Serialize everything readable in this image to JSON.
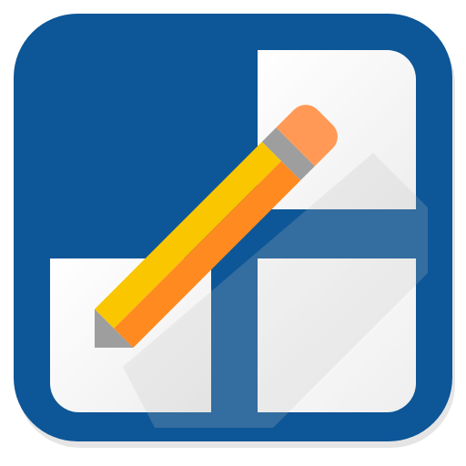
{
  "app_icon": {
    "icon_name": "edit-grid-pencil-icon",
    "colors": {
      "frame_blue": "#0D5697",
      "tile_white": "#FFFFFF",
      "shadow": "#BDBDBD",
      "pencil_yellow": "#F9C600",
      "pencil_orange": "#FF8A1F",
      "eraser": "#FF9955",
      "ferrule": "#9E9E9E",
      "wood_tip": "#9E9E9E"
    }
  }
}
